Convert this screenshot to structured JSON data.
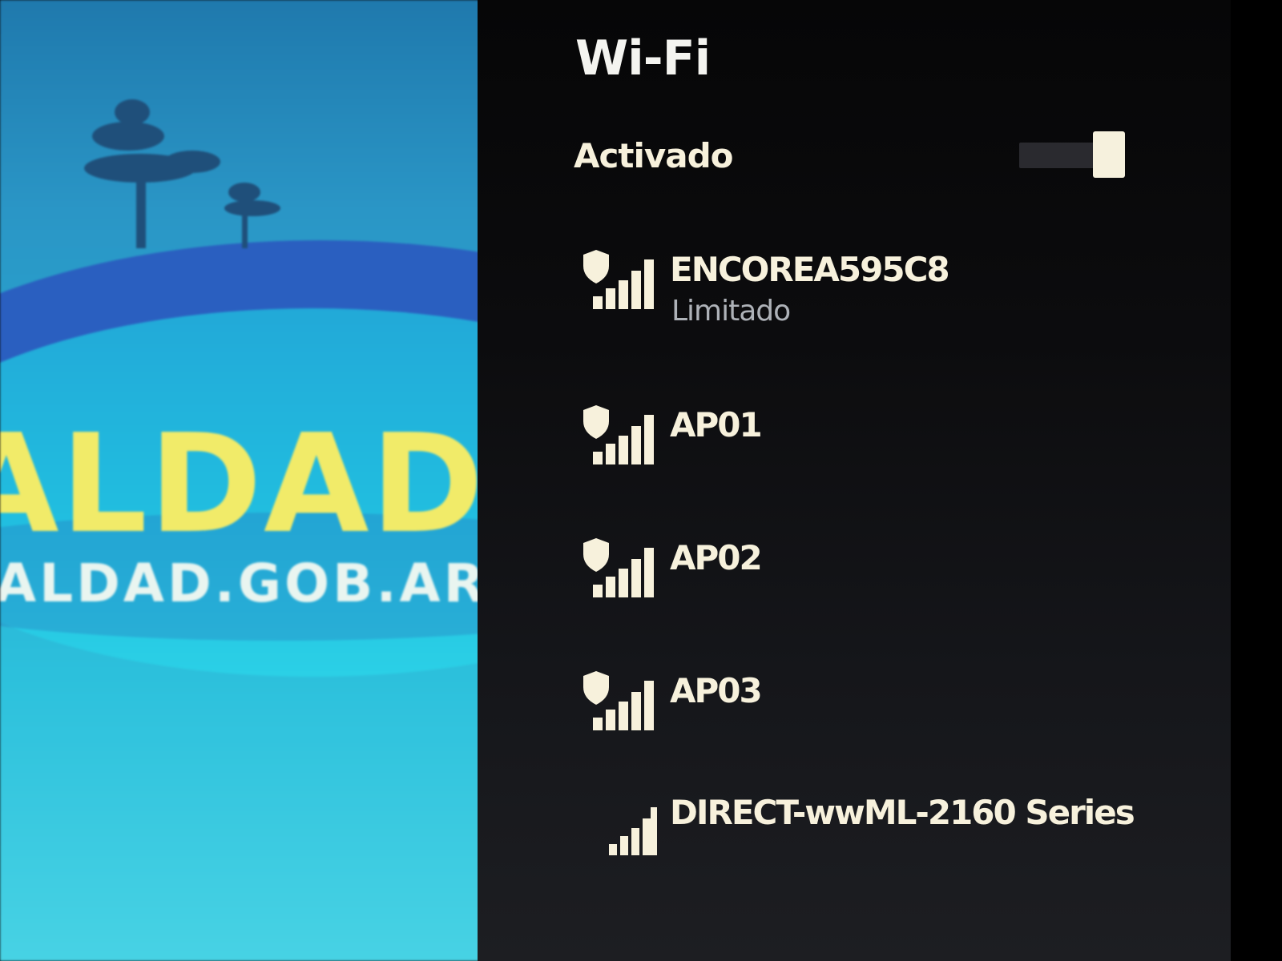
{
  "wallpaper": {
    "brand_yellow": "ALDAD",
    "url_text": "ALDAD.GOB.AR"
  },
  "wifi_panel": {
    "title": "Wi-Fi",
    "toggle": {
      "label": "Activado",
      "state": "on"
    },
    "networks": [
      {
        "name": "ENCOREA595C8",
        "status": "Limitado",
        "secured": true,
        "icon": "wifi-secured-icon"
      },
      {
        "name": "AP01",
        "status": "",
        "secured": true,
        "icon": "wifi-secured-icon"
      },
      {
        "name": "AP02",
        "status": "",
        "secured": true,
        "icon": "wifi-secured-icon"
      },
      {
        "name": "AP03",
        "status": "",
        "secured": true,
        "icon": "wifi-secured-icon"
      },
      {
        "name": "DIRECT-wwML-2160 Series",
        "status": "",
        "secured": false,
        "icon": "wifi-signal-icon"
      }
    ]
  },
  "colors": {
    "panel_bg": "#0c0c0e",
    "text": "#f7f1dc",
    "status_text": "#aeb2b8",
    "wallpaper_blue": "#27a6cf",
    "brand_yellow": "#f1eb69"
  }
}
